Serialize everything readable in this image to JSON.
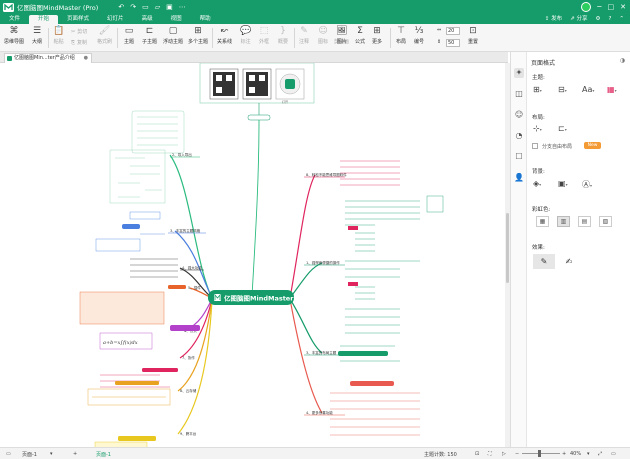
{
  "window": {
    "title": "亿图脑图MindMaster (Pro)",
    "publish": "发布",
    "share": "分享",
    "colors": {
      "brand": "#159c6a"
    }
  },
  "menu": {
    "items": [
      "文件",
      "开始",
      "页面样式",
      "幻灯片",
      "高级",
      "视图",
      "帮助"
    ],
    "active_index": 1
  },
  "ribbon": {
    "buttons": [
      "思维导图",
      "大纲",
      "粘贴",
      "剪切",
      "复制",
      "格式刷",
      "主题",
      "子主题",
      "浮动主题",
      "多个主题",
      "关系线",
      "标注",
      "外框",
      "概要",
      "注释",
      "图标",
      "剪贴画",
      "图片",
      "公式",
      "更多",
      "布局",
      "编号",
      "重置"
    ],
    "spin_top": "20",
    "spin_bottom": "50"
  },
  "tab": {
    "name": "亿图脑图Min...ter产品介绍"
  },
  "mindmap": {
    "center": "亿图脑图MindMaster",
    "right_branches": [
      {
        "label": "8、轻松不能思维导图软件",
        "color": "#e0245e"
      },
      {
        "label": "1、强悍而便捷的操作",
        "color": "#159c6a"
      },
      {
        "label": "3、丰富的布局主题",
        "color": "#159c6a"
      },
      {
        "label": "4、更多惊喜功能",
        "color": "#e85a4f"
      }
    ],
    "left_branches": [
      {
        "label": "2、导入导出",
        "color": "#2bbb7f"
      },
      {
        "label": "3、丰富的主题风格",
        "color": "#4a7fe0"
      },
      {
        "label": "4、强大功能",
        "color": "#333333"
      },
      {
        "label": "5、插件",
        "color": "#e8632a"
      },
      {
        "label": "6、公式",
        "color": "#b240c9"
      },
      {
        "label": "7、协作",
        "color": "#e0245e"
      },
      {
        "label": "8、云存储",
        "color": "#e8a21f"
      },
      {
        "label": "9、跨平台",
        "color": "#e8c81f"
      }
    ],
    "formula": "a+b=x∫f(x)dx"
  },
  "panel": {
    "title": "页面格式",
    "theme_label": "主题:",
    "font_label": "Aa",
    "layout_label": "布局:",
    "option_text": "分支自由布局",
    "new_badge": "New",
    "background_label": "背景:",
    "rainbow_label": "彩虹色:",
    "effect_label": "效果:"
  },
  "statusbar": {
    "page_left": "页面-1",
    "page_active": "页面-1",
    "topic_count": "主题计数: 150",
    "zoom": "40%"
  }
}
